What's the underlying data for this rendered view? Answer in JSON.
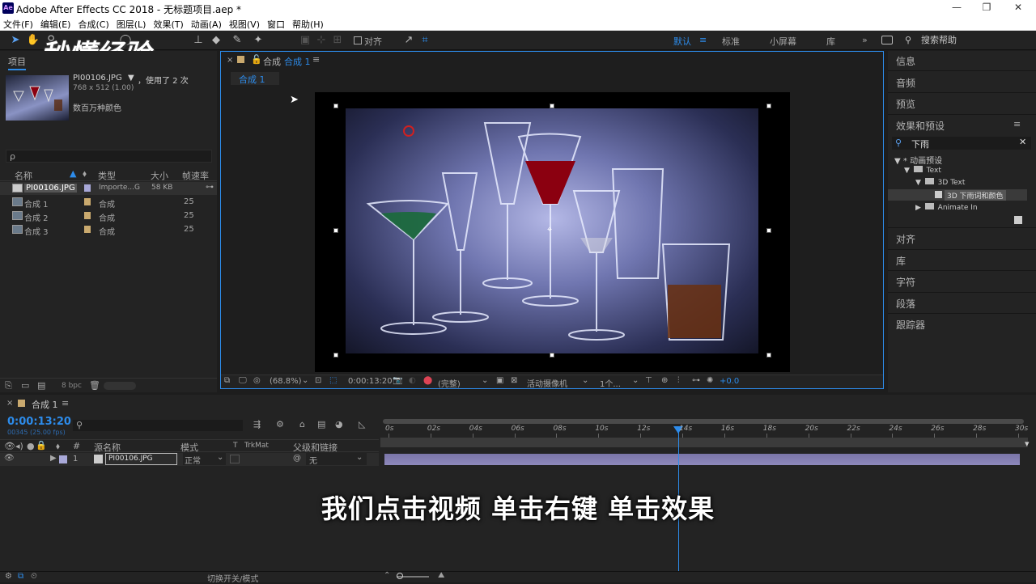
{
  "window": {
    "title": "Adobe After Effects CC 2018 - 无标题项目.aep *",
    "app_icon": "Ae",
    "minimize": "—",
    "maximize": "❐",
    "close": "✕"
  },
  "menu": [
    "文件(F)",
    "编辑(E)",
    "合成(C)",
    "图层(L)",
    "效果(T)",
    "动画(A)",
    "视图(V)",
    "窗口",
    "帮助(H)"
  ],
  "toolbar": {
    "align_label": "对齐",
    "workspaces": [
      "默认",
      "标准",
      "小屏幕",
      "库"
    ],
    "search_placeholder": "搜索帮助"
  },
  "watermark": "秒懂经验",
  "project": {
    "tab": "项目",
    "footage_name": "PI00106.JPG",
    "footage_used": "，使用了 2 次",
    "footage_dims": "768 x 512 (1.00)",
    "footage_colors": "数百万种颜色",
    "search_icon": "ρ",
    "columns": [
      "名称",
      "类型",
      "大小",
      "帧速率"
    ],
    "items": [
      {
        "name": "PI00106.JPG",
        "type": "Importe...G",
        "size": "58 KB",
        "fps": ""
      },
      {
        "name": "合成 1",
        "type": "合成",
        "size": "",
        "fps": "25"
      },
      {
        "name": "合成 2",
        "type": "合成",
        "size": "",
        "fps": "25"
      },
      {
        "name": "合成 3",
        "type": "合成",
        "size": "",
        "fps": "25"
      }
    ],
    "bpc": "8 bpc"
  },
  "composition": {
    "panel_title_prefix": "合成",
    "panel_title_name": "合成 1",
    "tab": "合成 1",
    "zoom": "(68.8%)",
    "timecode": "0:00:13:20",
    "resolution": "(完整)",
    "camera": "活动摄像机",
    "views": "1个...",
    "exposure": "+0.0"
  },
  "right_panel": {
    "items_top": [
      "信息",
      "音频",
      "预览"
    ],
    "effects_title": "效果和预设",
    "effects_search": "下雨",
    "tree": [
      {
        "label": "* 动画预设",
        "level": 0
      },
      {
        "label": "Text",
        "level": 1
      },
      {
        "label": "3D Text",
        "level": 2
      },
      {
        "label": "3D 下雨词和颜色",
        "level": 3
      },
      {
        "label": "Animate In",
        "level": 2
      }
    ],
    "items_bottom": [
      "对齐",
      "库",
      "字符",
      "段落",
      "跟踪器"
    ]
  },
  "timeline": {
    "tab": "合成 1",
    "timecode": "0:00:13:20",
    "frame_info": "00345 (25.00 fps)",
    "columns": {
      "source": "源名称",
      "mode": "模式",
      "t": "T",
      "trkmat": "TrkMat",
      "parent": "父级和链接"
    },
    "ruler": [
      "0s",
      "02s",
      "04s",
      "06s",
      "08s",
      "10s",
      "12s",
      "14s",
      "16s",
      "18s",
      "20s",
      "22s",
      "24s",
      "26s",
      "28s",
      "30s"
    ],
    "playhead_seconds": 13.8,
    "layer": {
      "index": "1",
      "name": "PI00106.JPG",
      "mode": "正常",
      "parent": "无"
    },
    "toggle_label": "切换开关/模式"
  },
  "subtitle": "我们点击视频  单击右键  单击效果"
}
